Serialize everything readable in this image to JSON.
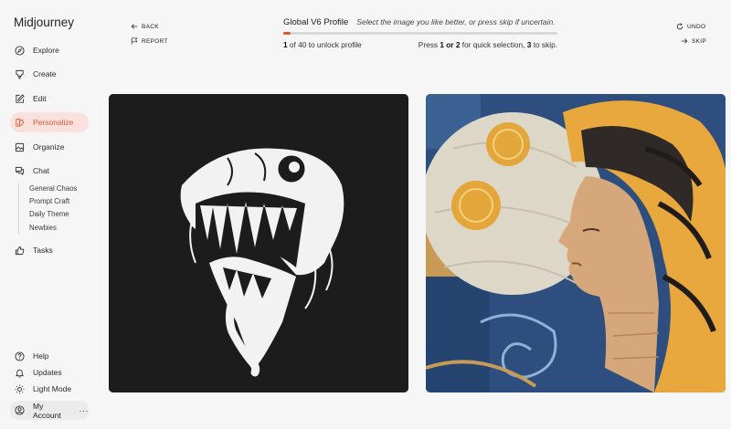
{
  "app": {
    "title": "Midjourney"
  },
  "sidebar": {
    "items": [
      {
        "label": "Explore",
        "icon": "compass-icon"
      },
      {
        "label": "Create",
        "icon": "brush-icon"
      },
      {
        "label": "Edit",
        "icon": "edit-icon"
      },
      {
        "label": "Personalize",
        "icon": "personalize-icon",
        "active": true
      },
      {
        "label": "Organize",
        "icon": "image-icon"
      },
      {
        "label": "Chat",
        "icon": "chat-icon"
      },
      {
        "label": "Tasks",
        "icon": "thumbs-up-icon"
      }
    ],
    "chat_rooms": [
      "General Chaos",
      "Prompt Craft",
      "Daily Theme",
      "Newbies"
    ],
    "bottom": [
      {
        "label": "Help",
        "icon": "help-icon"
      },
      {
        "label": "Updates",
        "icon": "bell-icon"
      },
      {
        "label": "Light Mode",
        "icon": "sun-icon"
      }
    ],
    "account": {
      "label": "My Account",
      "more": "···"
    }
  },
  "header": {
    "back_label": "BACK",
    "report_label": "REPORT",
    "undo_label": "UNDO",
    "skip_label": "SKIP",
    "title": "Global V6 Profile",
    "instruction": "Select the image you like better, or press skip if uncertain.",
    "progress": {
      "current": 1,
      "total": 40,
      "fraction": 0.025
    },
    "count_current": "1",
    "count_text": " of 40 to unlock profile",
    "hint": {
      "prefix": "Press ",
      "keys": "1 or 2",
      "middle": " for quick selection, ",
      "skip_key": "3",
      "suffix": " to skip."
    }
  },
  "images": [
    {
      "id": "left",
      "subject": "monster-skull-illustration"
    },
    {
      "id": "right",
      "subject": "mosaic-woman-portrait"
    }
  ],
  "colors": {
    "accent": "#e8553a",
    "active_bg": "#fbe1dc"
  }
}
